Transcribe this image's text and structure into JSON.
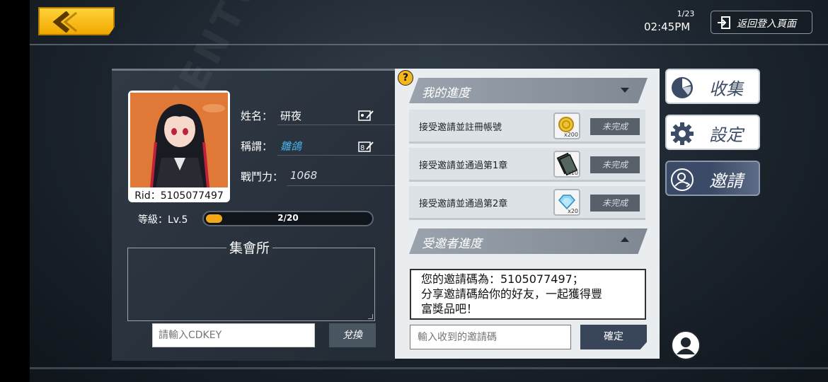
{
  "header": {
    "back_icon": "chevron-left-icon",
    "date": "1/23",
    "time": "02:45PM",
    "return_label": "返回登入頁面",
    "return_icon": "login-icon"
  },
  "profile": {
    "rid": "Rid：5105077497",
    "name_label": "姓名：",
    "name": "研夜",
    "title_label": "稱謂：",
    "title": "雛鴿",
    "power_label": "戰鬥力：",
    "power": "1068",
    "level_label": "等級：Lv.5",
    "exp_text": "2/20",
    "exp_fraction": 0.1,
    "hall_title": "集會所",
    "cdkey_placeholder": "請輸入CDKEY",
    "redeem_label": "兌換"
  },
  "progress": {
    "help_label": "?",
    "my_progress_title": "我的進度",
    "tasks": [
      {
        "label": "接受邀請並註冊帳號",
        "reward_icon": "gold-coin-icon",
        "reward_count": "x200",
        "status": "未完成"
      },
      {
        "label": "接受邀請並通過第1章",
        "reward_icon": "card-pack-icon",
        "reward_count": "x10",
        "status": "未完成"
      },
      {
        "label": "接受邀請並通過第2章",
        "reward_icon": "diamond-icon",
        "reward_count": "x20",
        "status": "未完成"
      }
    ],
    "invitee_title": "受邀者進度",
    "invite_message": "您的邀請碼為：5105077497；\n分享邀請碼給你的好友，一起獲得豐富獎品吧！",
    "invite_line1": "您的邀請碼為：5105077497；",
    "invite_line2": "分享邀請碼給你的好友，一起獲得豐",
    "invite_line3": "富獎品吧！",
    "invite_input_placeholder": "輸入收到的邀請碼",
    "confirm_label": "確定"
  },
  "side_nav": [
    {
      "label": "收集",
      "icon": "pie-chart-icon"
    },
    {
      "label": "設定",
      "icon": "gear-icon"
    },
    {
      "label": "邀請",
      "icon": "invite-user-icon"
    }
  ],
  "colors": {
    "accent": "#f3a817",
    "nav_active": "#3b4a66",
    "panel_light": "#e9edf0"
  }
}
